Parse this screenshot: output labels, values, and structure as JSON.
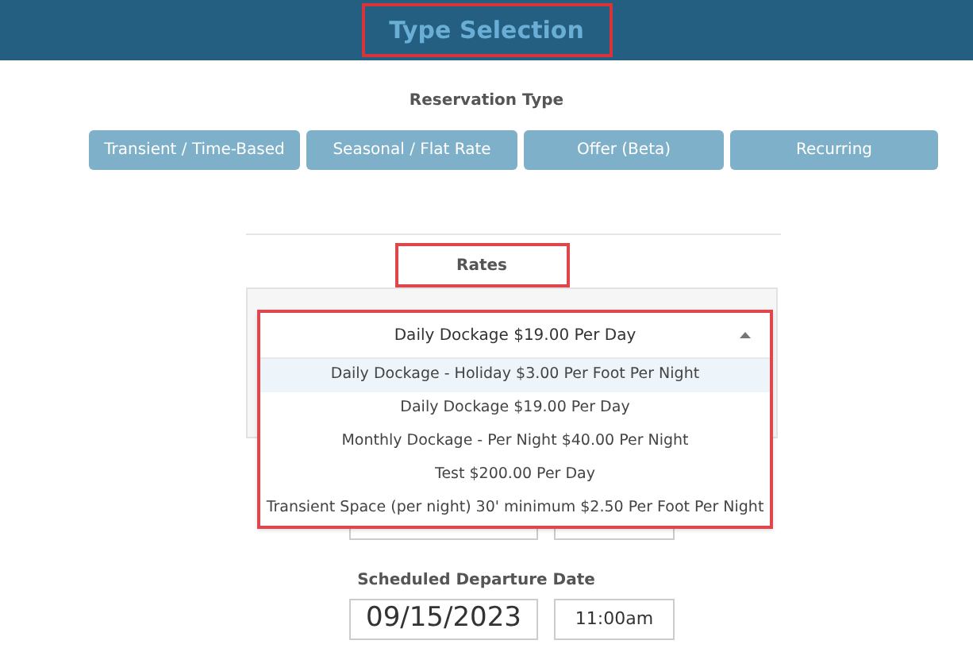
{
  "header": {
    "title": "Type Selection"
  },
  "reservation_type": {
    "label": "Reservation Type",
    "buttons": [
      "Transient / Time-Based",
      "Seasonal / Flat Rate",
      "Offer (Beta)",
      "Recurring"
    ]
  },
  "rates": {
    "label": "Rates",
    "select": {
      "value": "Daily Dockage $19.00 Per Day",
      "expanded": true
    },
    "options": [
      {
        "label": "Daily Dockage - Holiday $3.00 Per Foot Per Night",
        "highlighted": true
      },
      {
        "label": "Daily Dockage $19.00 Per Day",
        "highlighted": false
      },
      {
        "label": "Monthly Dockage - Per Night $40.00 Per Night",
        "highlighted": false
      },
      {
        "label": "Test $200.00 Per Day",
        "highlighted": false
      },
      {
        "label": "Transient Space (per night) 30' minimum $2.50 Per Foot Per Night",
        "highlighted": false
      }
    ]
  },
  "departure": {
    "label": "Scheduled Departure Date",
    "date": "09/15/2023",
    "time": "11:00am"
  }
}
